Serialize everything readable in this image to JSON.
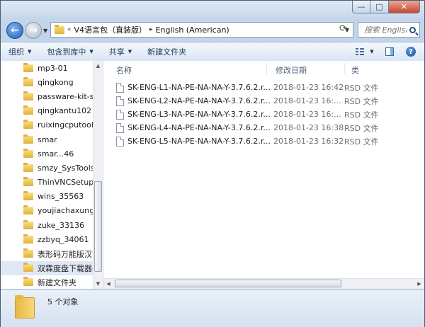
{
  "title_bar": {
    "min_glyph": "—",
    "max_glyph": "□",
    "close_glyph": "✕"
  },
  "address": {
    "overflow": "«",
    "crumbs": [
      "V4语言包（直装版）",
      "English (American)"
    ],
    "separator": "▸",
    "search_placeholder": "搜索 English (Am..."
  },
  "toolbar": {
    "organize": "组织",
    "include": "包含到库中",
    "share": "共享",
    "new_folder": "新建文件夹"
  },
  "nav_items": [
    "mp3-01",
    "qingkong",
    "passware-kit-st",
    "qingkantu102",
    "ruixingcputool",
    "smar",
    "smar...46",
    "smzy_SysToolsP",
    "ThinVNCSetup",
    "wins_35563",
    "youjiachaxungo",
    "zuke_33136",
    "zzbyq_34061",
    "表形码万能版汉字",
    "双霖度盘下载器-(",
    "新建文件夹"
  ],
  "columns": {
    "name": "名称",
    "date": "修改日期",
    "type": "类"
  },
  "files": [
    {
      "name": "SK-ENG-L1-NA-PE-NA-NA-Y-3.7.6.2.r...",
      "date": "2018-01-23 16:42",
      "type": "RSD 文件"
    },
    {
      "name": "SK-ENG-L2-NA-PE-NA-NA-Y-3.7.6.2.r...",
      "date": "2018-01-23 16:...",
      "type": "RSD 文件"
    },
    {
      "name": "SK-ENG-L3-NA-PE-NA-NA-Y-3.7.6.2.r...",
      "date": "2018-01-23 16:...",
      "type": "RSD 文件"
    },
    {
      "name": "SK-ENG-L4-NA-PE-NA-NA-Y-3.7.6.2.r...",
      "date": "2018-01-23 16:38",
      "type": "RSD 文件"
    },
    {
      "name": "SK-ENG-L5-NA-PE-NA-NA-Y-3.7.6.2.r...",
      "date": "2018-01-23 16:32",
      "type": "RSD 文件"
    }
  ],
  "status": {
    "count": "5 个对象"
  },
  "icons": {
    "back": "back-arrow-icon",
    "forward": "forward-arrow-icon",
    "folder": "folder-icon",
    "file": "file-icon",
    "search": "search-icon",
    "refresh": "refresh-icon",
    "help": "help-icon"
  }
}
